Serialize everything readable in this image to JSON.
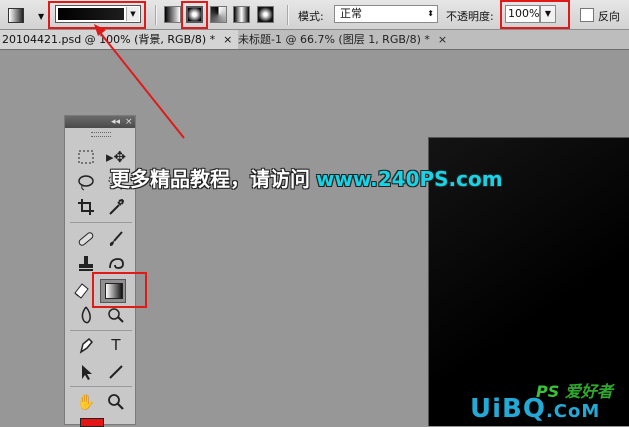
{
  "options_bar": {
    "tool_preset_icon": "gradient-tool-icon",
    "gradient_types": [
      "linear",
      "radial",
      "angle",
      "reflected",
      "diamond"
    ],
    "selected_gradient_type": "radial",
    "mode_label": "模式:",
    "mode_value": "正常",
    "opacity_label": "不透明度:",
    "opacity_value": "100%",
    "reverse_label": "反向"
  },
  "tabs": [
    {
      "label": "20104421.psd @ 100% (背景, RGB/8) *",
      "close": "×"
    },
    {
      "label": "未标题-1 @ 66.7% (图层 1, RGB/8) *",
      "close": "×"
    }
  ],
  "toolbox": {
    "collapse": "◂◂",
    "close": "×",
    "tools": [
      "marquee-icon",
      "move-icon",
      "lasso-icon",
      "quick-select-icon",
      "crop-icon",
      "eyedropper-icon",
      "healing-brush-icon",
      "brush-icon",
      "clone-stamp-icon",
      "history-brush-icon",
      "eraser-icon",
      "gradient-icon",
      "blur-icon",
      "dodge-icon",
      "pen-icon",
      "type-icon",
      "path-select-icon",
      "line-icon",
      "hand-icon",
      "zoom-icon"
    ],
    "type_glyph": "T",
    "active_tool": "gradient"
  },
  "foreground_color": "#e51616",
  "accent_color": "#e01919",
  "overlay": {
    "cta": "更多精品教程，请访问",
    "url": "www.240PS.com"
  },
  "logos": {
    "ps_text": "PS",
    "ps_cn": "爱好者",
    "uibq": "UiBQ",
    "uibq_domain": ".CoM"
  }
}
